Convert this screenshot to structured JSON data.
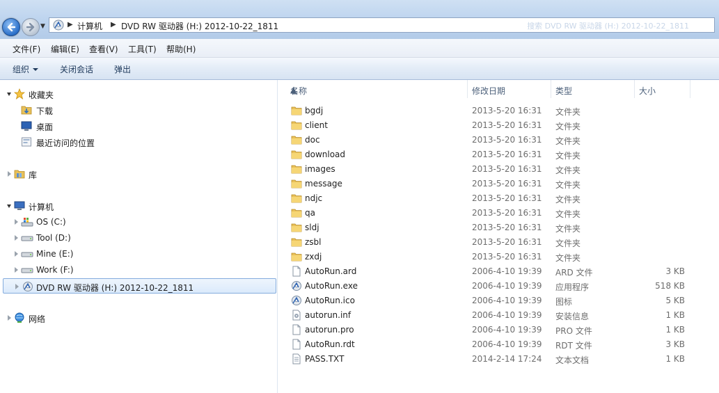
{
  "address": {
    "segments": [
      "计算机",
      "DVD RW 驱动器 (H:) 2012-10-22_1811"
    ],
    "ghost": "搜索 DVD RW 驱动器 (H:) 2012-10-22_1811"
  },
  "menu": [
    "文件(F)",
    "编辑(E)",
    "查看(V)",
    "工具(T)",
    "帮助(H)"
  ],
  "commands": {
    "organize": "组织",
    "close_session": "关闭会话",
    "eject": "弹出"
  },
  "tree": {
    "favorites": "收藏夹",
    "downloads": "下载",
    "desktop": "桌面",
    "recent": "最近访问的位置",
    "libraries": "库",
    "computer": "计算机",
    "drive_c": "OS (C:)",
    "drive_d": "Tool (D:)",
    "drive_e": "Mine (E:)",
    "drive_f": "Work (F:)",
    "drive_h": "DVD RW 驱动器 (H:) 2012-10-22_1811",
    "network": "网络"
  },
  "columns": {
    "name": "名称",
    "date": "修改日期",
    "type": "类型",
    "size": "大小"
  },
  "files": [
    {
      "name": "bgdj",
      "date": "2013-5-20 16:31",
      "type": "文件夹",
      "size": "",
      "icon": "folder"
    },
    {
      "name": "client",
      "date": "2013-5-20 16:31",
      "type": "文件夹",
      "size": "",
      "icon": "folder"
    },
    {
      "name": "doc",
      "date": "2013-5-20 16:31",
      "type": "文件夹",
      "size": "",
      "icon": "folder"
    },
    {
      "name": "download",
      "date": "2013-5-20 16:31",
      "type": "文件夹",
      "size": "",
      "icon": "folder"
    },
    {
      "name": "images",
      "date": "2013-5-20 16:31",
      "type": "文件夹",
      "size": "",
      "icon": "folder"
    },
    {
      "name": "message",
      "date": "2013-5-20 16:31",
      "type": "文件夹",
      "size": "",
      "icon": "folder"
    },
    {
      "name": "ndjc",
      "date": "2013-5-20 16:31",
      "type": "文件夹",
      "size": "",
      "icon": "folder"
    },
    {
      "name": "qa",
      "date": "2013-5-20 16:31",
      "type": "文件夹",
      "size": "",
      "icon": "folder"
    },
    {
      "name": "sldj",
      "date": "2013-5-20 16:31",
      "type": "文件夹",
      "size": "",
      "icon": "folder"
    },
    {
      "name": "zsbl",
      "date": "2013-5-20 16:31",
      "type": "文件夹",
      "size": "",
      "icon": "folder"
    },
    {
      "name": "zxdj",
      "date": "2013-5-20 16:31",
      "type": "文件夹",
      "size": "",
      "icon": "folder"
    },
    {
      "name": "AutoRun.ard",
      "date": "2006-4-10 19:39",
      "type": "ARD 文件",
      "size": "3 KB",
      "icon": "file"
    },
    {
      "name": "AutoRun.exe",
      "date": "2006-4-10 19:39",
      "type": "应用程序",
      "size": "518 KB",
      "icon": "exe"
    },
    {
      "name": "AutoRun.ico",
      "date": "2006-4-10 19:39",
      "type": "图标",
      "size": "5 KB",
      "icon": "ico"
    },
    {
      "name": "autorun.inf",
      "date": "2006-4-10 19:39",
      "type": "安装信息",
      "size": "1 KB",
      "icon": "inf"
    },
    {
      "name": "autorun.pro",
      "date": "2006-4-10 19:39",
      "type": "PRO 文件",
      "size": "1 KB",
      "icon": "file"
    },
    {
      "name": "AutoRun.rdt",
      "date": "2006-4-10 19:39",
      "type": "RDT 文件",
      "size": "3 KB",
      "icon": "file"
    },
    {
      "name": "PASS.TXT",
      "date": "2014-2-14 17:24",
      "type": "文本文档",
      "size": "1 KB",
      "icon": "txt"
    }
  ]
}
